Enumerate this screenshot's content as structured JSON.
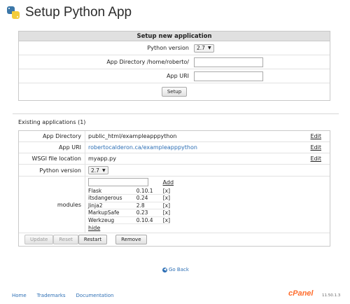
{
  "header": {
    "title": "Setup Python App",
    "logo_icon": "python-logo-icon"
  },
  "setup": {
    "heading": "Setup new application",
    "python_version_label": "Python version",
    "python_version_value": "2.7",
    "app_directory_label": "App Directory /home/roberto/",
    "app_directory_value": "",
    "app_uri_label": "App URI",
    "app_uri_value": "",
    "setup_button": "Setup"
  },
  "existing": {
    "title": "Existing applications (1)",
    "rows": [
      {
        "label": "App Directory",
        "value": "public_html/exampleapppython",
        "edit": "Edit"
      },
      {
        "label": "App URI",
        "value": "robertocalderon.ca/exampleapppython",
        "edit": "Edit"
      },
      {
        "label": "WSGI file location",
        "value": "myapp.py",
        "edit": "Edit"
      }
    ],
    "python_version_label": "Python version",
    "python_version_value": "2.7",
    "modules_label": "modules",
    "add_label": "Add",
    "modules": [
      {
        "name": "Flask",
        "version": "0.10.1",
        "remove": "[x]"
      },
      {
        "name": "itsdangerous",
        "version": "0.24",
        "remove": "[x]"
      },
      {
        "name": "Jinja2",
        "version": "2.8",
        "remove": "[x]"
      },
      {
        "name": "MarkupSafe",
        "version": "0.23",
        "remove": "[x]"
      },
      {
        "name": "Werkzeug",
        "version": "0.10.4",
        "remove": "[x]"
      }
    ],
    "hide_label": "hide",
    "buttons": {
      "update": "Update",
      "reset": "Reset",
      "restart": "Restart",
      "remove": "Remove"
    }
  },
  "go_back": "Go Back",
  "footer": {
    "links": [
      "Home",
      "Trademarks",
      "Documentation"
    ],
    "brand": "cPanel",
    "version": "11.50.1.3"
  },
  "colors": {
    "link": "#2d6fb5",
    "brand": "#ff6c2c",
    "panel_header": "#e0e0e0"
  }
}
